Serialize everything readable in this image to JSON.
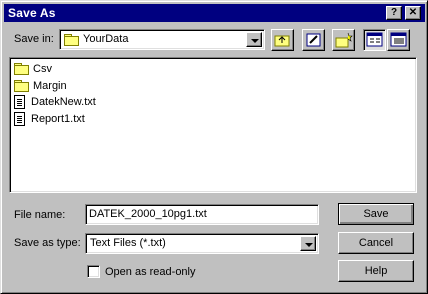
{
  "window": {
    "title": "Save As",
    "help_btn": "?",
    "close_btn": "✕"
  },
  "savein": {
    "label": "Save in:",
    "value": "YourData"
  },
  "toolbar": {
    "icons": [
      "up-one-level-icon",
      "desktop-icon",
      "new-folder-icon",
      "list-view-icon",
      "details-view-icon"
    ]
  },
  "files": [
    {
      "name": "Csv",
      "type": "folder"
    },
    {
      "name": "Margin",
      "type": "folder"
    },
    {
      "name": "DatekNew.txt",
      "type": "file"
    },
    {
      "name": "Report1.txt",
      "type": "file"
    }
  ],
  "filename": {
    "label": "File name:",
    "value": "DATEK_2000_10pg1.txt"
  },
  "savetype": {
    "label": "Save as type:",
    "value": "Text Files (*.txt)"
  },
  "readonly": {
    "label": "Open as read-only",
    "checked": false
  },
  "buttons": {
    "save": "Save",
    "cancel": "Cancel",
    "help": "Help"
  },
  "colors": {
    "titlebar": "#000080",
    "face": "#c0c0c0"
  }
}
